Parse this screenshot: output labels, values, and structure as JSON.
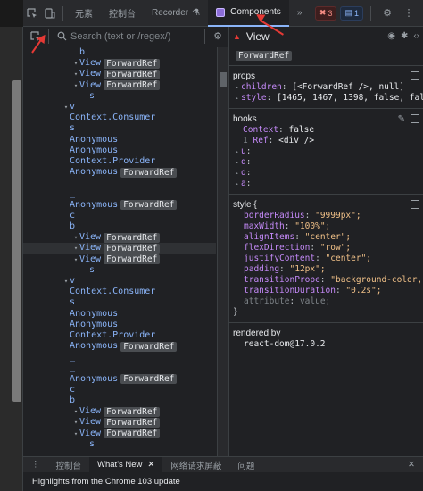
{
  "toolbar": {
    "tabs": [
      {
        "label": "元素",
        "active": false
      },
      {
        "label": "控制台",
        "active": false
      },
      {
        "label": "Recorder",
        "active": false
      },
      {
        "label": "Components",
        "active": true
      }
    ],
    "more_label": "»",
    "error_count": "3",
    "message_count": "1"
  },
  "search": {
    "placeholder": "Search (text or /regex/)"
  },
  "tree": {
    "rows": [
      {
        "indent": 5,
        "arrow": "",
        "name": "b",
        "badge": ""
      },
      {
        "indent": 5,
        "arrow": "▾",
        "name": "View",
        "badge": "ForwardRef"
      },
      {
        "indent": 5,
        "arrow": "▾",
        "name": "View",
        "badge": "ForwardRef"
      },
      {
        "indent": 5,
        "arrow": "▾",
        "name": "View",
        "badge": "ForwardRef"
      },
      {
        "indent": 6,
        "arrow": "",
        "name": "s",
        "badge": ""
      },
      {
        "indent": 4,
        "arrow": "▾",
        "name": "v",
        "badge": ""
      },
      {
        "indent": 4,
        "arrow": "",
        "name": "Context.Consumer",
        "badge": ""
      },
      {
        "indent": 4,
        "arrow": "",
        "name": "s",
        "badge": ""
      },
      {
        "indent": 4,
        "arrow": "",
        "name": "Anonymous",
        "badge": ""
      },
      {
        "indent": 4,
        "arrow": "",
        "name": "Anonymous",
        "badge": ""
      },
      {
        "indent": 4,
        "arrow": "",
        "name": "Context.Provider",
        "badge": ""
      },
      {
        "indent": 4,
        "arrow": "",
        "name": "Anonymous",
        "badge": "ForwardRef"
      },
      {
        "indent": 4,
        "arrow": "",
        "name": "_",
        "badge": ""
      },
      {
        "indent": 4,
        "arrow": "",
        "name": "_",
        "badge": ""
      },
      {
        "indent": 4,
        "arrow": "",
        "name": "Anonymous",
        "badge": "ForwardRef"
      },
      {
        "indent": 4,
        "arrow": "",
        "name": "c",
        "badge": ""
      },
      {
        "indent": 4,
        "arrow": "",
        "name": "b",
        "badge": ""
      },
      {
        "indent": 5,
        "arrow": "▾",
        "name": "View",
        "badge": "ForwardRef"
      },
      {
        "indent": 5,
        "arrow": "▾",
        "name": "View",
        "badge": "ForwardRef",
        "selected": true
      },
      {
        "indent": 5,
        "arrow": "▾",
        "name": "View",
        "badge": "ForwardRef"
      },
      {
        "indent": 6,
        "arrow": "",
        "name": "s",
        "badge": ""
      },
      {
        "indent": 4,
        "arrow": "▾",
        "name": "v",
        "badge": ""
      },
      {
        "indent": 4,
        "arrow": "",
        "name": "Context.Consumer",
        "badge": ""
      },
      {
        "indent": 4,
        "arrow": "",
        "name": "s",
        "badge": ""
      },
      {
        "indent": 4,
        "arrow": "",
        "name": "Anonymous",
        "badge": ""
      },
      {
        "indent": 4,
        "arrow": "",
        "name": "Anonymous",
        "badge": ""
      },
      {
        "indent": 4,
        "arrow": "",
        "name": "Context.Provider",
        "badge": ""
      },
      {
        "indent": 4,
        "arrow": "",
        "name": "Anonymous",
        "badge": "ForwardRef"
      },
      {
        "indent": 4,
        "arrow": "",
        "name": "_",
        "badge": ""
      },
      {
        "indent": 4,
        "arrow": "",
        "name": "_",
        "badge": ""
      },
      {
        "indent": 4,
        "arrow": "",
        "name": "Anonymous",
        "badge": "ForwardRef"
      },
      {
        "indent": 4,
        "arrow": "",
        "name": "c",
        "badge": ""
      },
      {
        "indent": 4,
        "arrow": "",
        "name": "b",
        "badge": ""
      },
      {
        "indent": 5,
        "arrow": "▾",
        "name": "View",
        "badge": "ForwardRef"
      },
      {
        "indent": 5,
        "arrow": "▾",
        "name": "View",
        "badge": "ForwardRef"
      },
      {
        "indent": 5,
        "arrow": "▾",
        "name": "View",
        "badge": "ForwardRef"
      },
      {
        "indent": 6,
        "arrow": "",
        "name": "s",
        "badge": ""
      }
    ]
  },
  "panel": {
    "title": "View",
    "badge": "ForwardRef",
    "props": {
      "header": "props",
      "lines": [
        {
          "key": "children",
          "value": "[<ForwardRef />, null]"
        },
        {
          "key": "style",
          "value": "[1465, 1467, 1398, false, false, fal…"
        }
      ]
    },
    "hooks": {
      "header": "hooks",
      "context_key": "Context",
      "context_value": "false",
      "ref_index": "1",
      "ref_key": "Ref",
      "ref_value": "<div />",
      "extra_keys": [
        "u",
        "q",
        "d",
        "a"
      ]
    },
    "style": {
      "header": "style {",
      "closing": "}",
      "lines": [
        {
          "key": "borderRadius",
          "value": "\"9999px\";"
        },
        {
          "key": "maxWidth",
          "value": "\"100%\";"
        },
        {
          "key": "alignItems",
          "value": "\"center\";"
        },
        {
          "key": "flexDirection",
          "value": "\"row\";"
        },
        {
          "key": "justifyContent",
          "value": "\"center\";"
        },
        {
          "key": "padding",
          "value": "\"12px\";"
        },
        {
          "key": "transitionPrope",
          "value": "\"background-color, box-sha"
        },
        {
          "key": "transitionDuration",
          "value": "\"0.2s\";"
        },
        {
          "key": "attribute",
          "value": "value;",
          "dim": true
        }
      ]
    },
    "rendered_by": {
      "header": "rendered by",
      "value": "react-dom@17.0.2"
    }
  },
  "drawer": {
    "tabs": [
      {
        "label": "控制台",
        "active": false
      },
      {
        "label": "What's New",
        "active": true
      },
      {
        "label": "网络请求屏蔽",
        "active": false
      },
      {
        "label": "问题",
        "active": false
      }
    ],
    "body_text": "Highlights from the Chrome 103 update"
  },
  "accent_colors": {
    "component_name": "#8ab4f8",
    "prop_key": "#c58af9",
    "string_value": "#f1c188",
    "annotation_arrow": "#e53935"
  }
}
